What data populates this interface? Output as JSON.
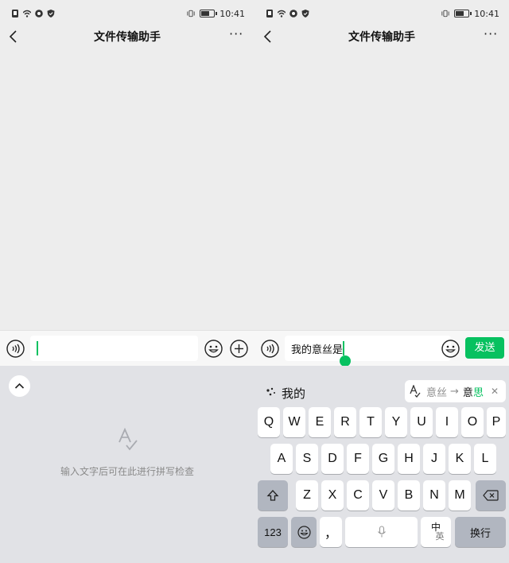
{
  "colors": {
    "accent": "#07c160",
    "chat_bg": "#ededed",
    "keyboard_bg": "#e1e2e6",
    "key_fn": "#b1b6c0"
  },
  "status_bar": {
    "time": "10:41",
    "left_icons": [
      "notification-icon",
      "wifi-icon",
      "app-icon",
      "shield-icon"
    ],
    "right_icons": [
      "vibrate-icon",
      "battery-icon"
    ],
    "battery_level": 0.55
  },
  "left_screen": {
    "title": "文件传输助手",
    "more_label": "···",
    "input": {
      "value": ""
    },
    "spell_check_hint": "输入文字后可在此进行拼写检查"
  },
  "right_screen": {
    "title": "文件传输助手",
    "more_label": "···",
    "input": {
      "value": "我的意丝是"
    },
    "send_label": "发送",
    "candidate": "我的",
    "suggestion": {
      "from": "意丝",
      "arrow": "→",
      "to_plain": "意",
      "to_highlight": "思",
      "close": "✕"
    },
    "keyboard": {
      "row1": [
        "Q",
        "W",
        "E",
        "R",
        "T",
        "Y",
        "U",
        "I",
        "O",
        "P"
      ],
      "row2": [
        "A",
        "S",
        "D",
        "F",
        "G",
        "H",
        "J",
        "K",
        "L"
      ],
      "row3": [
        "Z",
        "X",
        "C",
        "V",
        "B",
        "N",
        "M"
      ],
      "key_123": "123",
      "key_punct": "，",
      "key_lang_top": "中",
      "key_lang_bottom": "英",
      "key_enter": "换行"
    }
  }
}
